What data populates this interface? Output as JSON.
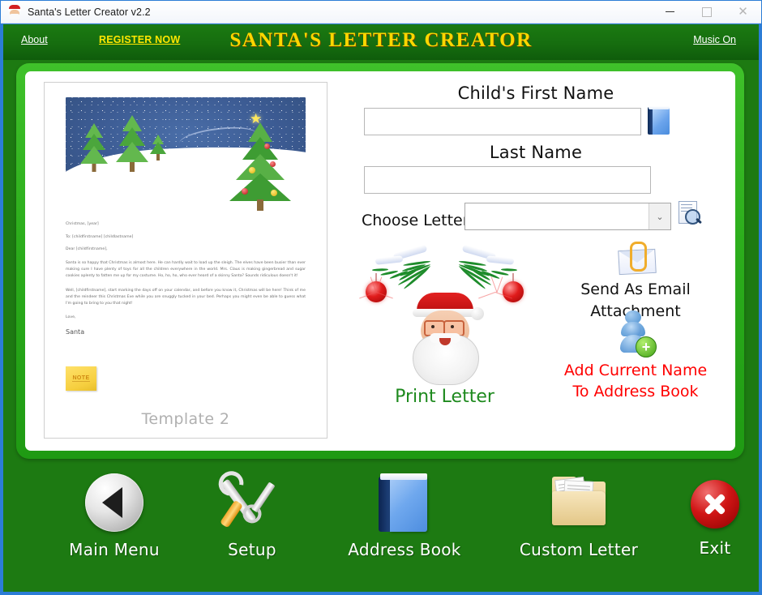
{
  "window": {
    "title": "Santa's Letter Creator v2.2",
    "icon": "santa-icon",
    "minimize": "–",
    "maximize": "□",
    "close": "✕"
  },
  "header": {
    "about": "About",
    "register": "REGISTER NOW",
    "title": "SANTA'S LETTER CREATOR",
    "music": "Music On",
    "title_color": "#ffd700",
    "register_color": "#ffe600",
    "bar_color": "#166d0f"
  },
  "preview": {
    "template_label": "Template 2",
    "date_line": "Christmas, [year]",
    "to_line": "To: [childfirstname] [childlastname]",
    "salutation": "Dear [childfirstname],",
    "paragraph1": "Santa is so happy that Christmas is almost here. He can hardly wait to load up the sleigh. The elves have been busier than ever making sure I have plenty of toys for all the children everywhere in the world. Mrs. Claus is making gingerbread and sugar cookies aplenty to fatten me up for my costume. Ho, ho, ho, who ever heard of a skinny Santa? Sounds ridiculous doesn't it!",
    "paragraph2": "Well, [childfirstname], start marking the days off on your calendar, and before you know it, Christmas will be here! Think of me and the reindeer this Christmas Eve while you are snuggly tucked in your bed. Perhaps you might even be able to guess what I'm going to bring to you that night!",
    "closing": "Love,",
    "signature": "Santa",
    "note_badge": "NOTE"
  },
  "form": {
    "first_name_label": "Child's First Name",
    "first_name_value": "",
    "first_name_placeholder": "",
    "last_name_label": "Last Name",
    "last_name_value": "",
    "last_name_placeholder": "",
    "choose_letter_label": "Choose Letter",
    "choose_letter_value": "",
    "choose_letter_options": [],
    "address_book_icon": "blue-book-icon",
    "preview_letter_icon": "document-search-icon",
    "dropdown_arrow": "⌄"
  },
  "actions": {
    "print_letter": "Print Letter",
    "print_letter_color": "#1e8a1e",
    "send_email_line1": "Send As Email",
    "send_email_line2": "Attachment",
    "add_name_line1": "Add Current Name",
    "add_name_line2": "To Address Book",
    "add_name_color": "#ff0000"
  },
  "toolbar": {
    "items": [
      {
        "label": "Main Menu",
        "icon": "back-arrow-icon"
      },
      {
        "label": "Setup",
        "icon": "tools-icon"
      },
      {
        "label": "Address Book",
        "icon": "book-icon"
      },
      {
        "label": "Custom Letter",
        "icon": "folder-document-icon"
      },
      {
        "label": "Exit",
        "icon": "close-circle-icon"
      }
    ]
  }
}
